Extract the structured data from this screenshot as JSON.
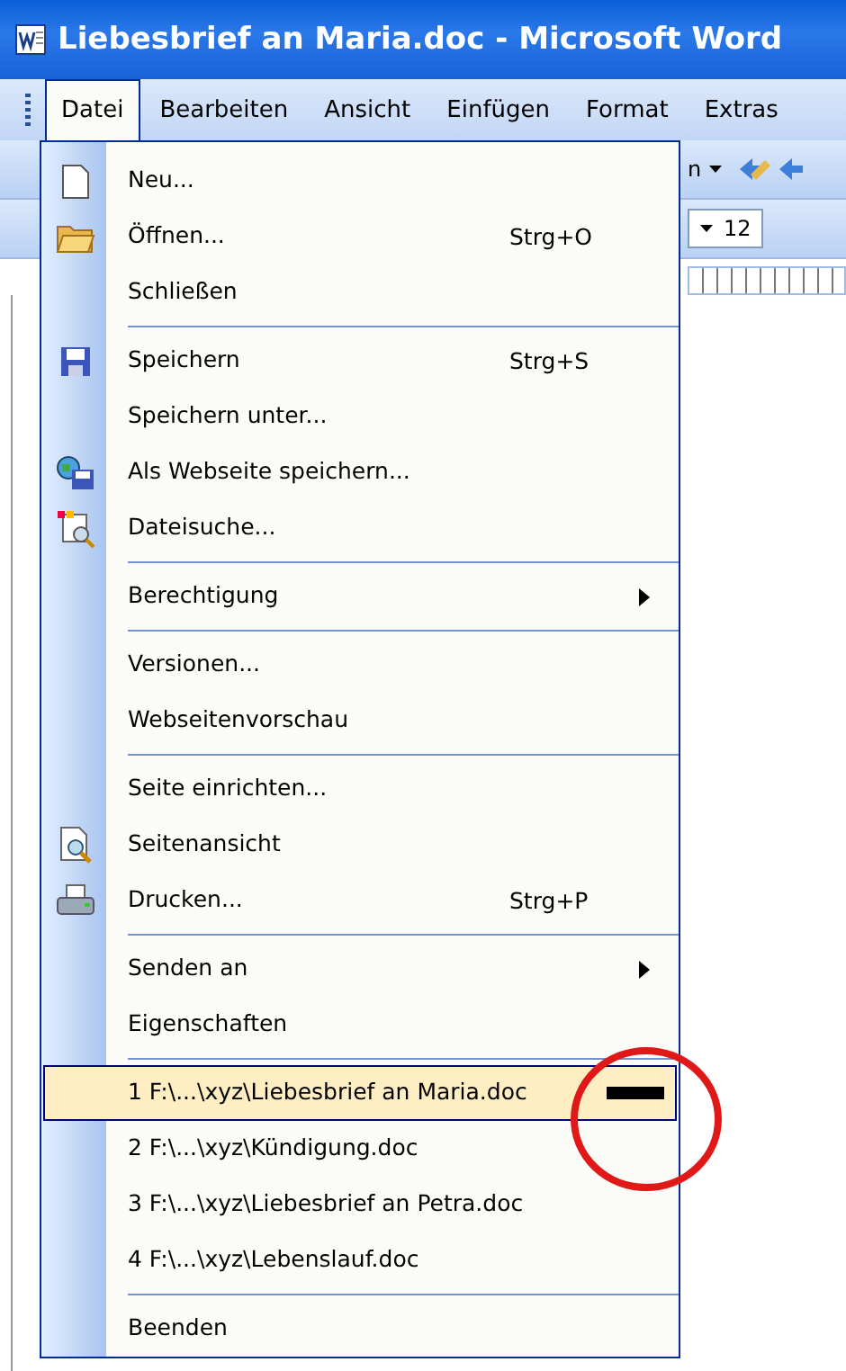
{
  "window": {
    "title": "Liebesbrief an Maria.doc - Microsoft Word"
  },
  "menubar": [
    {
      "label": "Datei",
      "selected": true
    },
    {
      "label": "Bearbeiten",
      "selected": false
    },
    {
      "label": "Ansicht",
      "selected": false
    },
    {
      "label": "Einfügen",
      "selected": false
    },
    {
      "label": "Format",
      "selected": false
    },
    {
      "label": "Extras",
      "selected": false
    }
  ],
  "toolbar": {
    "button_label": "n",
    "font_size": "12"
  },
  "menu": [
    {
      "kind": "item",
      "label": "Neu...",
      "selected": false
    },
    {
      "kind": "item",
      "label": "Öffnen...",
      "shortcut": "Strg+O",
      "selected": false
    },
    {
      "kind": "item",
      "label": "Schließen",
      "selected": false
    },
    {
      "kind": "separator"
    },
    {
      "kind": "item",
      "label": "Speichern",
      "shortcut": "Strg+S",
      "selected": false
    },
    {
      "kind": "item",
      "label": "Speichern unter...",
      "selected": false
    },
    {
      "kind": "item",
      "label": "Als Webseite speichern...",
      "selected": false
    },
    {
      "kind": "item",
      "label": "Dateisuche...",
      "selected": false
    },
    {
      "kind": "separator"
    },
    {
      "kind": "item",
      "label": "Berechtigung",
      "submenu": true,
      "selected": false
    },
    {
      "kind": "separator"
    },
    {
      "kind": "item",
      "label": "Versionen...",
      "selected": false
    },
    {
      "kind": "item",
      "label": "Webseitenvorschau",
      "selected": false
    },
    {
      "kind": "separator"
    },
    {
      "kind": "item",
      "label": "Seite einrichten...",
      "selected": false
    },
    {
      "kind": "item",
      "label": "Seitenansicht",
      "selected": false
    },
    {
      "kind": "item",
      "label": "Drucken...",
      "shortcut": "Strg+P",
      "selected": false
    },
    {
      "kind": "separator"
    },
    {
      "kind": "item",
      "label": "Senden an",
      "submenu": true,
      "selected": false
    },
    {
      "kind": "item",
      "label": "Eigenschaften",
      "selected": false
    },
    {
      "kind": "separator"
    },
    {
      "kind": "item",
      "label": "1 F:\\...\\xyz\\Liebesbrief an Maria.doc",
      "selected": true
    },
    {
      "kind": "item",
      "label": "2 F:\\...\\xyz\\Kündigung.doc",
      "selected": false
    },
    {
      "kind": "item",
      "label": "3 F:\\...\\xyz\\Liebesbrief an Petra.doc",
      "selected": false
    },
    {
      "kind": "item",
      "label": "4 F:\\...\\xyz\\Lebenslauf.doc",
      "selected": false
    },
    {
      "kind": "separator"
    },
    {
      "kind": "item",
      "label": "Beenden",
      "selected": false
    }
  ]
}
